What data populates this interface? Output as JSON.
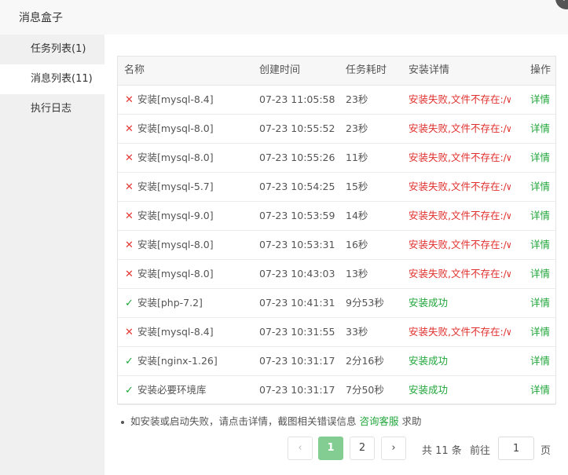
{
  "window": {
    "title": "消息盒子",
    "close_symbol": "✕"
  },
  "sidebar": {
    "items": [
      {
        "label": "任务列表(1)"
      },
      {
        "label": "消息列表(11)"
      },
      {
        "label": "执行日志"
      }
    ],
    "active_index": 1
  },
  "table": {
    "columns": [
      "名称",
      "创建时间",
      "任务耗时",
      "安装详情",
      "操作"
    ],
    "rows": [
      {
        "status": "fail",
        "status_symbol": "✕",
        "name": "安装[mysql-8.4]",
        "time": "07-23 11:05:58",
        "duration": "23秒",
        "detail": "安装失败,文件不存在:/ww",
        "action": "详情"
      },
      {
        "status": "fail",
        "status_symbol": "✕",
        "name": "安装[mysql-8.0]",
        "time": "07-23 10:55:52",
        "duration": "23秒",
        "detail": "安装失败,文件不存在:/ww",
        "action": "详情"
      },
      {
        "status": "fail",
        "status_symbol": "✕",
        "name": "安装[mysql-8.0]",
        "time": "07-23 10:55:26",
        "duration": "11秒",
        "detail": "安装失败,文件不存在:/ww",
        "action": "详情"
      },
      {
        "status": "fail",
        "status_symbol": "✕",
        "name": "安装[mysql-5.7]",
        "time": "07-23 10:54:25",
        "duration": "15秒",
        "detail": "安装失败,文件不存在:/ww",
        "action": "详情"
      },
      {
        "status": "fail",
        "status_symbol": "✕",
        "name": "安装[mysql-9.0]",
        "time": "07-23 10:53:59",
        "duration": "14秒",
        "detail": "安装失败,文件不存在:/ww",
        "action": "详情"
      },
      {
        "status": "fail",
        "status_symbol": "✕",
        "name": "安装[mysql-8.0]",
        "time": "07-23 10:53:31",
        "duration": "16秒",
        "detail": "安装失败,文件不存在:/ww",
        "action": "详情"
      },
      {
        "status": "fail",
        "status_symbol": "✕",
        "name": "安装[mysql-8.0]",
        "time": "07-23 10:43:03",
        "duration": "13秒",
        "detail": "安装失败,文件不存在:/ww",
        "action": "详情"
      },
      {
        "status": "ok",
        "status_symbol": "✓",
        "name": "安装[php-7.2]",
        "time": "07-23 10:41:31",
        "duration": "9分53秒",
        "detail": "安装成功",
        "action": "详情"
      },
      {
        "status": "fail",
        "status_symbol": "✕",
        "name": "安装[mysql-8.4]",
        "time": "07-23 10:31:55",
        "duration": "33秒",
        "detail": "安装失败,文件不存在:/ww",
        "action": "详情"
      },
      {
        "status": "ok",
        "status_symbol": "✓",
        "name": "安装[nginx-1.26]",
        "time": "07-23 10:31:17",
        "duration": "2分16秒",
        "detail": "安装成功",
        "action": "详情"
      },
      {
        "status": "ok",
        "status_symbol": "✓",
        "name": "安装必要环境库",
        "time": "07-23 10:31:17",
        "duration": "7分50秒",
        "detail": "安装成功",
        "action": "详情"
      }
    ]
  },
  "tip": {
    "text": "如安装或启动失败，请点击详情，截图相关错误信息",
    "link": "咨询客服",
    "suffix": "求助"
  },
  "pagination": {
    "prev_symbol": "‹",
    "next_symbol": "›",
    "pages": [
      "1",
      "2"
    ],
    "current": "1",
    "total_text": "共 11 条",
    "goto_label": "前往",
    "goto_value": "1",
    "page_suffix": "页"
  },
  "colors": {
    "accent": "#20a53a",
    "error": "#e0302d"
  }
}
